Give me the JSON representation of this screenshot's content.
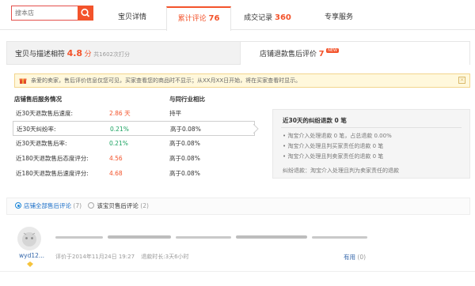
{
  "search": {
    "placeholder": "搜本店"
  },
  "tabs": [
    {
      "label": "宝贝详情"
    },
    {
      "label": "累计评论",
      "count": "76"
    },
    {
      "label": "成交记录",
      "count": "360"
    },
    {
      "label": "专享服务"
    }
  ],
  "score": {
    "label": "宝贝与描述相符",
    "value": "4.8",
    "unit": "分",
    "count_text": "共1602次打分",
    "refund_label": "店铺退款售后评价",
    "refund_value": "7",
    "new_badge": "NEW"
  },
  "notice": {
    "text": "亲爱的卖家，售后评价信息仅您可见，买家查看您的商品时不显示；从XX月XX日开始，将在买家查看时显示。"
  },
  "stats": {
    "header_left": "店铺售后服务情况",
    "header_right": "与同行业相比",
    "rows": [
      {
        "label": "近30天退款售后速度:",
        "value": "2.86 天",
        "value_color": "red",
        "compare": "持平"
      },
      {
        "label": "近30天纠纷率:",
        "value": "0.21%",
        "value_color": "green",
        "compare": "高于0.08%"
      },
      {
        "label": "近30天退款售后率:",
        "value": "0.21%",
        "value_color": "green",
        "compare": "高于0.08%"
      },
      {
        "label": "近180天退款售后态度评分:",
        "value": "4.56",
        "value_color": "red",
        "compare": "高于0.08%"
      },
      {
        "label": "近180天退款售后速度评分:",
        "value": "4.68",
        "value_color": "red",
        "compare": "高于0.08%"
      }
    ]
  },
  "detail": {
    "title": "近30天的纠纷退款 0 笔",
    "items": [
      "淘宝介入处理退款 0 笔，占总退款 0.00%",
      "淘宝介入处理且判买家责任的退款 0 笔",
      "淘宝介入处理且判卖家责任的退款 0 笔"
    ],
    "footer": "纠纷退款：淘宝介入处理且判为卖家责任的退款"
  },
  "filter": {
    "opt1_label": "店铺全部售后评论",
    "opt1_count": "(7)",
    "opt2_label": "该宝贝售后评论",
    "opt2_count": "(2)"
  },
  "review": {
    "user": "wyd12...",
    "date": "评价于2014年11月24日 19:27",
    "duration": "退款时长:3天6小时",
    "useful_label": "有用",
    "useful_count": "(0)"
  },
  "colors": {
    "accent": "#f3532b",
    "link": "#1b6fc8",
    "green": "#1aa260"
  }
}
